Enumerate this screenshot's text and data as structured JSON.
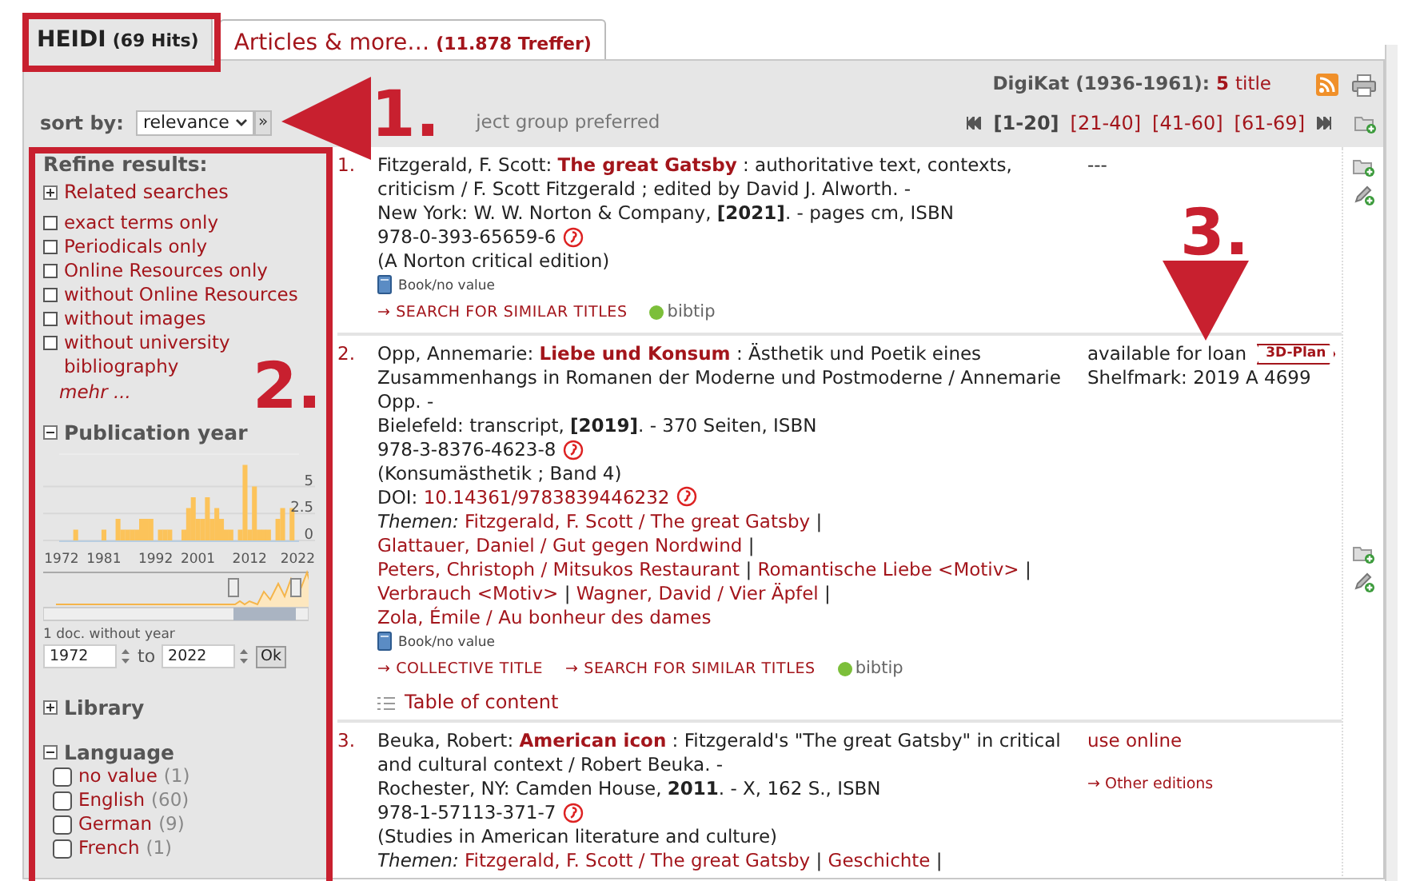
{
  "tabs": [
    {
      "label": "HEIDI",
      "count": "(69 Hits)",
      "selected": true
    },
    {
      "label": "Articles & more…",
      "count": "(11.878 Treffer)",
      "selected": false
    }
  ],
  "header": {
    "digikat_label": "DigiKat (1936-1961):",
    "digikat_count": "5",
    "digikat_unit": "title",
    "sort_label": "sort by:",
    "sort_value": "relevance",
    "sort_go": "»",
    "sort_note": "ject group preferred",
    "pages": [
      {
        "label": "[1-20]",
        "selected": true
      },
      {
        "label": "[21-40]",
        "selected": false
      },
      {
        "label": "[41-60]",
        "selected": false
      },
      {
        "label": "[61-69]",
        "selected": false
      }
    ]
  },
  "sidebar": {
    "title": "Refine results:",
    "related": {
      "label": "Related searches",
      "expanded": false
    },
    "filters": [
      {
        "label": "exact terms only",
        "checked": false
      },
      {
        "label": "Periodicals only",
        "checked": false
      },
      {
        "label": "Online Resources only",
        "checked": false
      },
      {
        "label": "without Online Resources",
        "checked": false
      },
      {
        "label": "without images",
        "checked": false
      },
      {
        "label": "without university bibliography",
        "checked": false
      }
    ],
    "more": "mehr ...",
    "year": {
      "label": "Publication year",
      "expanded": true,
      "chart_data": {
        "type": "bar",
        "x": [
          1972,
          1973,
          1974,
          1975,
          1976,
          1977,
          1978,
          1979,
          1980,
          1981,
          1982,
          1983,
          1984,
          1985,
          1986,
          1987,
          1988,
          1989,
          1990,
          1991,
          1992,
          1993,
          1994,
          1995,
          1996,
          1997,
          1998,
          1999,
          2000,
          2001,
          2002,
          2003,
          2004,
          2005,
          2006,
          2007,
          2008,
          2009,
          2010,
          2011,
          2012,
          2013,
          2014,
          2015,
          2016,
          2017,
          2018,
          2019,
          2020,
          2021,
          2022
        ],
        "values": [
          0,
          0,
          0,
          1,
          0,
          0,
          0,
          0,
          0,
          1,
          0,
          0,
          2,
          1,
          1,
          1,
          1,
          2,
          2,
          2,
          0,
          1,
          1,
          1,
          0,
          0,
          1,
          3,
          4,
          2,
          2,
          4,
          2,
          3,
          2,
          1,
          1,
          0,
          1,
          7,
          1,
          5,
          1,
          1,
          1,
          0,
          2,
          3,
          0,
          3,
          0
        ],
        "xticks": [
          1972,
          1981,
          1992,
          2001,
          2012,
          2022
        ],
        "yticks": [
          0,
          2.5,
          5
        ],
        "xlim": [
          1971.5,
          2022.5
        ],
        "ylim": [
          0,
          8
        ]
      },
      "without_year": "1 doc. without year",
      "from": "1972",
      "to_label": "to",
      "to": "2022",
      "ok": "Ok"
    },
    "library": {
      "label": "Library",
      "expanded": false
    },
    "language": {
      "label": "Language",
      "expanded": true,
      "options": [
        {
          "label": "no value",
          "count": "(1)",
          "checked": false
        },
        {
          "label": "English",
          "count": "(60)",
          "checked": false
        },
        {
          "label": "German",
          "count": "(9)",
          "checked": false
        },
        {
          "label": "French",
          "count": "(1)",
          "checked": false
        }
      ]
    }
  },
  "records": [
    {
      "number": "1.",
      "author": "Fitzgerald, F. Scott:",
      "title": "The great Gatsby",
      "statement": ": authoritative text, contexts, criticism / F. Scott Fitzgerald ; edited by David J. Alworth. -",
      "publication": "New York: W. W. Norton & Company, **[2021]**. - pages cm, ISBN",
      "isbn": "978-0-393-65659-6",
      "series": "(A Norton critical edition)",
      "medium": "Book/no value",
      "links": [
        "→ SEARCH FOR SIMILAR TITLES"
      ],
      "bibtip": "bibtip",
      "availability": {
        "kind": "none",
        "text": "---"
      }
    },
    {
      "number": "2.",
      "author": "Opp, Annemarie:",
      "title": "Liebe und Konsum",
      "statement": ": Ästhetik und Poetik eines Zusammenhangs in Romanen der Moderne und Postmoderne / Annemarie Opp. -",
      "publication": "Bielefeld: transcript, **[2019]**. - 370 Seiten, ISBN",
      "isbn": "978-3-8376-4623-8",
      "series": "(Konsumästhetik ; Band 4)",
      "doi_label": "DOI:",
      "doi": "10.14361/9783839446232",
      "subjects_label": "Themen:",
      "subject_separator": "|",
      "subjects": [
        "Fitzgerald, F. Scott / The great Gatsby",
        "Glattauer, Daniel / Gut gegen Nordwind",
        "Peters, Christoph / Mitsukos Restaurant",
        "Romantische Liebe <Motiv>",
        "Verbrauch <Motiv>",
        "Wagner, David / Vier Äpfel",
        "Zola, Émile / Au bonheur des dames"
      ],
      "medium": "Book/no value",
      "links": [
        "→ COLLECTIVE TITLE",
        "→ SEARCH FOR SIMILAR TITLES"
      ],
      "bibtip": "bibtip",
      "toc": "Table of content",
      "availability": {
        "kind": "loan",
        "text": "available for loan",
        "badge": "3D-Plan",
        "shelfmark": "Shelfmark: 2019 A 4699"
      }
    },
    {
      "number": "3.",
      "author": "Beuka, Robert:",
      "title": "American icon",
      "statement": ": Fitzgerald's \"The great Gatsby\" in critical and cultural context / Robert Beuka. -",
      "publication": "Rochester, NY: Camden House, **2011**. - X, 162 S., ISBN",
      "isbn": "978-1-57113-371-7",
      "series": "(Studies in American literature and culture)",
      "subjects_label": "Themen:",
      "subject_separator": "|",
      "subjects": [
        "Fitzgerald, F. Scott / The great Gatsby",
        "Geschichte"
      ],
      "subjects_continue": true,
      "availability": {
        "kind": "online",
        "text": "use online",
        "link": "→ Other editions"
      }
    }
  ],
  "annotations": [
    {
      "label": "1.",
      "kind": "arrow-left"
    },
    {
      "label": "2.",
      "kind": "label"
    },
    {
      "label": "3.",
      "kind": "arrow-down"
    }
  ]
}
